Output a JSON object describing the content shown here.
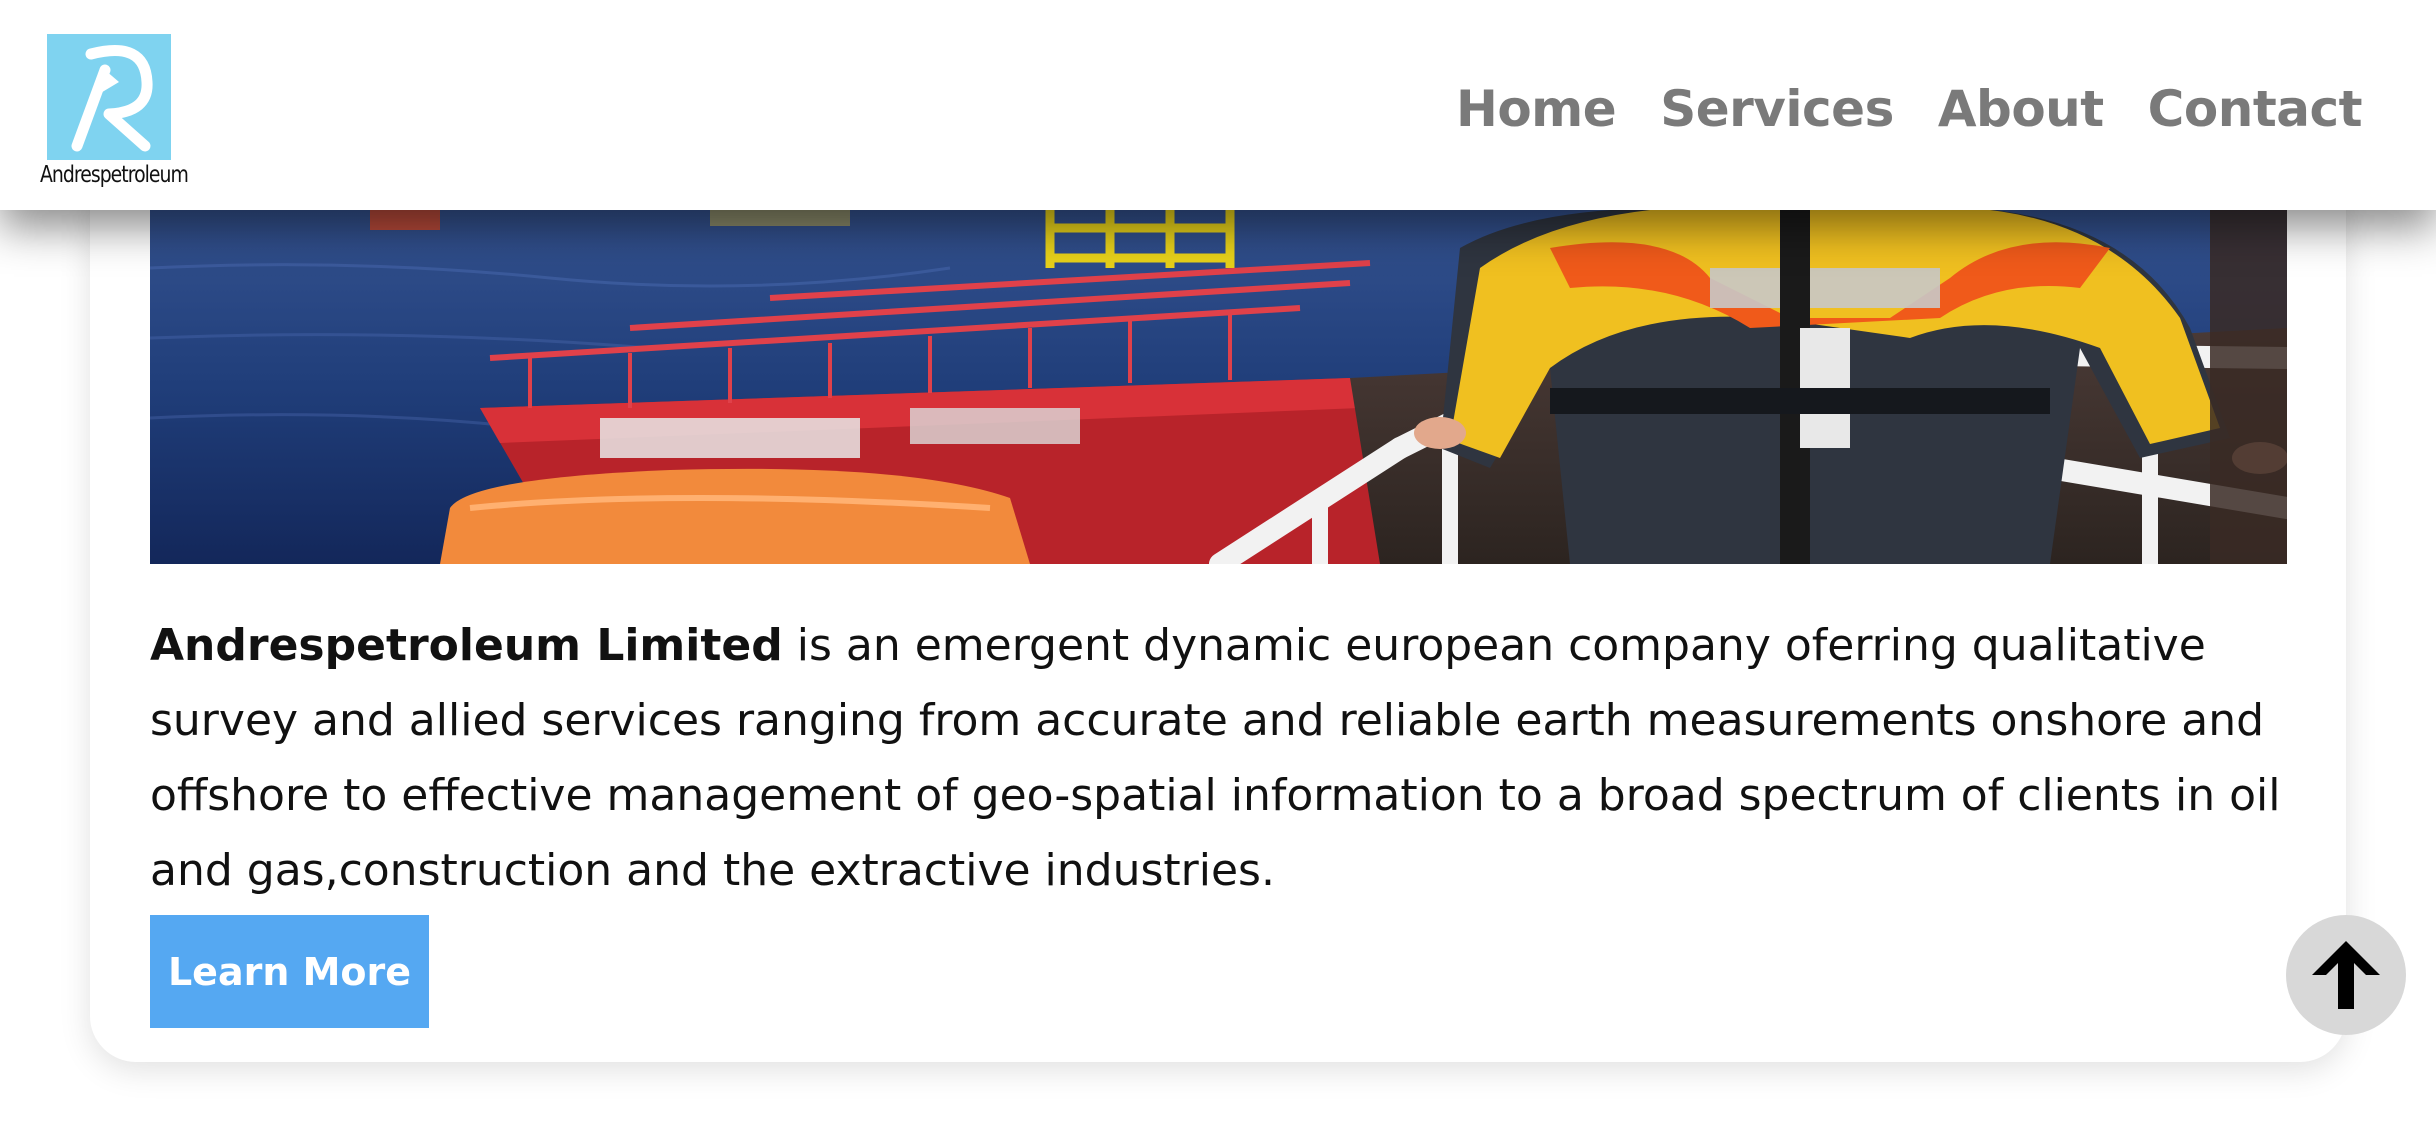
{
  "brand": {
    "name": "Andrespetroleum",
    "logo_icon": "letter-r-arrow-logo",
    "logo_color": "#7fd3f0"
  },
  "nav": {
    "items": [
      {
        "label": "Home"
      },
      {
        "label": "Services"
      },
      {
        "label": "About"
      },
      {
        "label": "Contact"
      }
    ],
    "color": "#7a7a7a"
  },
  "hero": {
    "image_subject": "offshore-vessel-worker-photo"
  },
  "intro": {
    "company_name": "Andrespetroleum Limited",
    "body": " is an emergent dynamic european company oferring qualitative survey and allied services ranging from accurate and reliable earth measurements onshore and offshore to effective management of geo-spatial information to a broad spectrum of clients in oil and gas,construction and the extractive industries."
  },
  "cta": {
    "label": "Learn More",
    "color": "#55a8f2"
  },
  "scroll_top": {
    "icon": "arrow-up-icon"
  }
}
